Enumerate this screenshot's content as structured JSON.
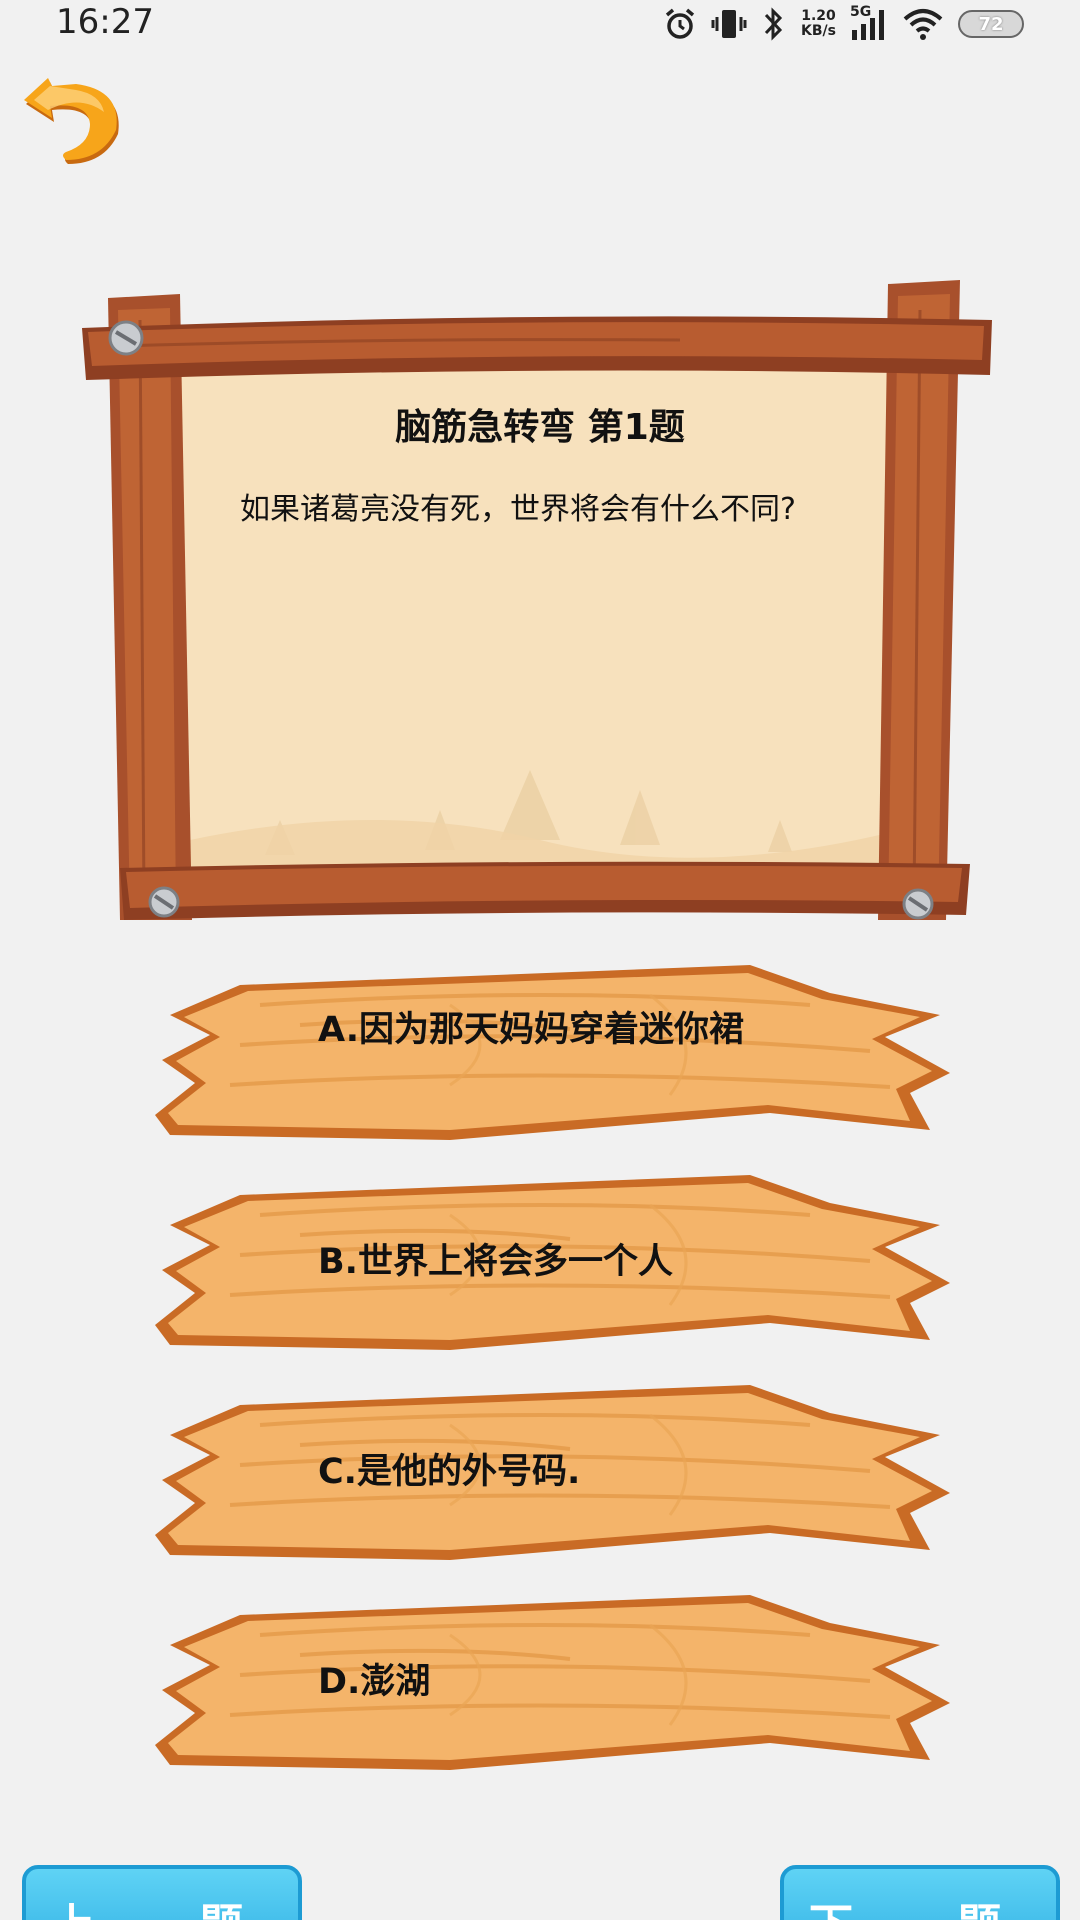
{
  "status_bar": {
    "time": "16:27",
    "net_speed_value": "1.20",
    "net_speed_unit": "KB/s",
    "network_type": "5G",
    "battery_level": "72",
    "icons": [
      "alarm-icon",
      "vibrate-icon",
      "bluetooth-icon",
      "signal-icon",
      "wifi-icon",
      "battery-icon"
    ]
  },
  "back_button": {
    "icon": "undo-arrow-icon"
  },
  "question": {
    "title": "脑筋急转弯 第1题",
    "text": "如果诸葛亮没有死，世界将会有什么不同?"
  },
  "answers": [
    {
      "label": "A.因为那天妈妈穿着迷你裙"
    },
    {
      "label": "B.世界上将会多一个人"
    },
    {
      "label": "C.是他的外号码."
    },
    {
      "label": "D.澎湖"
    }
  ],
  "nav": {
    "prev_label": "上一题",
    "next_label": "下一题"
  },
  "colors": {
    "background": "#f1f1f1",
    "frame_wood": "#a8502c",
    "parchment": "#f7e1bd",
    "plank_wood": "#f4b46a",
    "nav_button": "#27a9e1",
    "back_arrow": "#f7a51a"
  }
}
